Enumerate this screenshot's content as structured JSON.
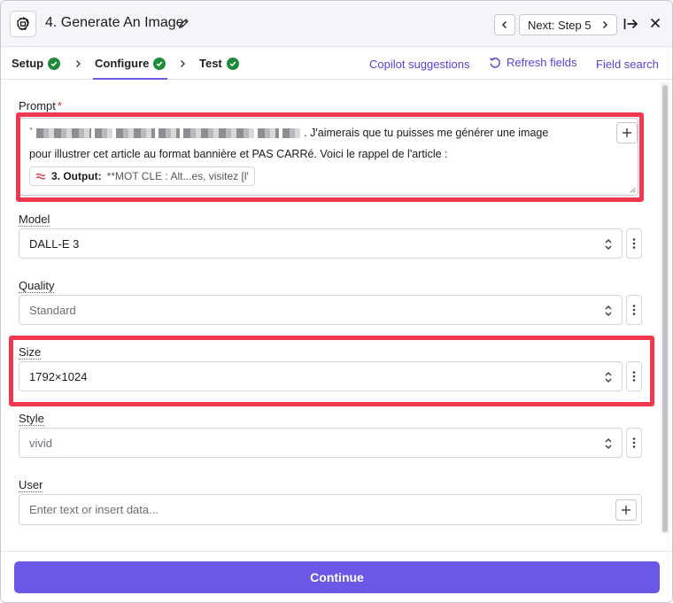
{
  "header": {
    "step_title": "4. Generate An Image",
    "next_label": "Next: Step 5"
  },
  "tabs": {
    "items": [
      {
        "label": "Setup",
        "status": "complete"
      },
      {
        "label": "Configure",
        "status": "complete",
        "active": true
      },
      {
        "label": "Test",
        "status": "complete"
      }
    ],
    "links": {
      "copilot": "Copilot suggestions",
      "refresh": "Refresh fields",
      "search": "Field search"
    }
  },
  "fields": {
    "prompt": {
      "label": "Prompt",
      "required_mark": "*",
      "line1_text": ". J'aimerais que tu puisses me générer une image",
      "line2_text": "pour illustrer cet article au format bannière et PAS CARRé. Voici le rappel de l'article :",
      "pill_title": "3. Output:",
      "pill_value": "**MOT CLE : Alt...es, visitez [l'"
    },
    "model": {
      "label": "Model",
      "value": "DALL-E 3"
    },
    "quality": {
      "label": "Quality",
      "value": "Standard"
    },
    "size": {
      "label": "Size",
      "value": "1792×1024"
    },
    "style": {
      "label": "Style",
      "value": "vivid"
    },
    "user": {
      "label": "User",
      "placeholder": "Enter text or insert data..."
    }
  },
  "footer": {
    "continue_label": "Continue"
  },
  "colors": {
    "accent": "#6a59e6",
    "link": "#5443d6",
    "success": "#1f8b3a",
    "highlight": "#f2384f",
    "required": "#d92d3a"
  },
  "icons": [
    "openai-logo-icon",
    "pencil-icon",
    "chevron-left-icon",
    "chevron-right-icon",
    "collapse-panel-icon",
    "close-icon",
    "check-circle-icon",
    "refresh-icon",
    "plus-icon",
    "updown-chevron-icon",
    "more-vertical-icon",
    "approx-icon"
  ]
}
